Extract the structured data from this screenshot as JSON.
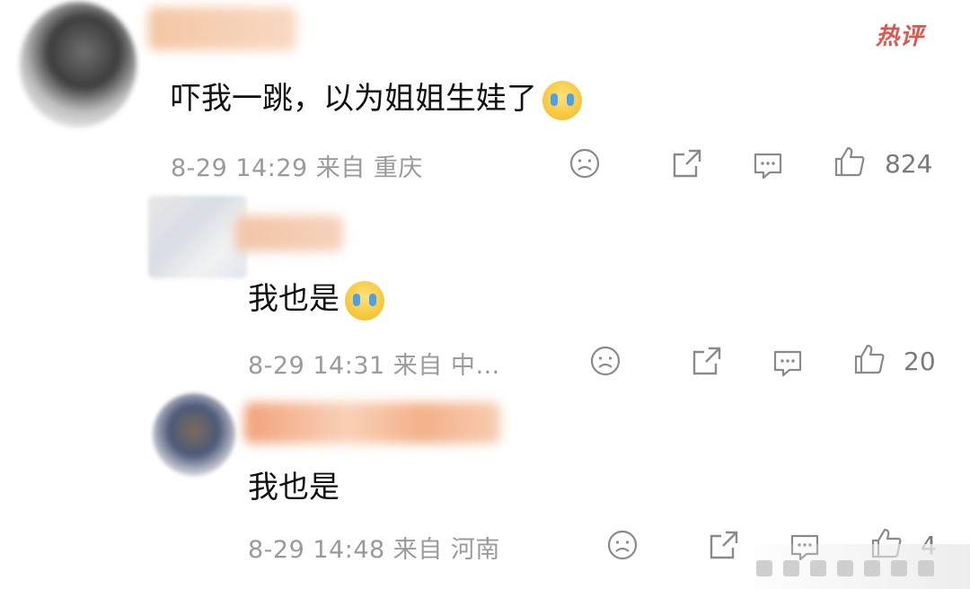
{
  "hot_label": "热评",
  "comments": [
    {
      "text": "吓我一跳，以为姐姐生娃了",
      "meta": "8-29 14:29 来自 重庆",
      "likes": "824",
      "emoji": "crying-laughing-emoji"
    },
    {
      "text": "我也是",
      "meta": "8-29 14:31 来自 中…",
      "likes": "20",
      "emoji": "crying-emoji"
    },
    {
      "text": "我也是",
      "meta": "8-29 14:48 来自 河南",
      "likes": "4"
    }
  ],
  "colors": {
    "hot": "#e0554c",
    "meta": "#9a9a9a",
    "icon": "#8a8a8a"
  },
  "icons": [
    "dislike-face-icon",
    "share-icon",
    "reply-icon",
    "like-thumb-icon"
  ]
}
